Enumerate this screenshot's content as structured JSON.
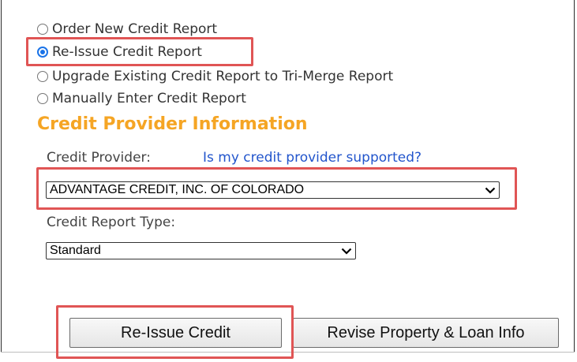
{
  "options": [
    {
      "label": "Order New Credit Report",
      "checked": false
    },
    {
      "label": "Re-Issue Credit Report",
      "checked": true
    },
    {
      "label": "Upgrade Existing Credit Report to Tri-Merge Report",
      "checked": false
    },
    {
      "label": "Manually Enter Credit Report",
      "checked": false
    }
  ],
  "section_title": "Credit Provider Information",
  "provider": {
    "label": "Credit Provider:",
    "help_link": "Is my credit provider supported?",
    "selected": "ADVANTAGE CREDIT, INC. OF COLORADO"
  },
  "report_type": {
    "label": "Credit Report Type:",
    "selected": "Standard"
  },
  "buttons": {
    "reissue": "Re-Issue Credit",
    "revise": "Revise Property & Loan Info"
  },
  "colors": {
    "section_title": "#f5a524",
    "link": "#2255cc",
    "radio_checked": "#1a73e8",
    "highlight": "#e05555"
  },
  "icons": {
    "dropdown": "chevron-down-icon"
  }
}
